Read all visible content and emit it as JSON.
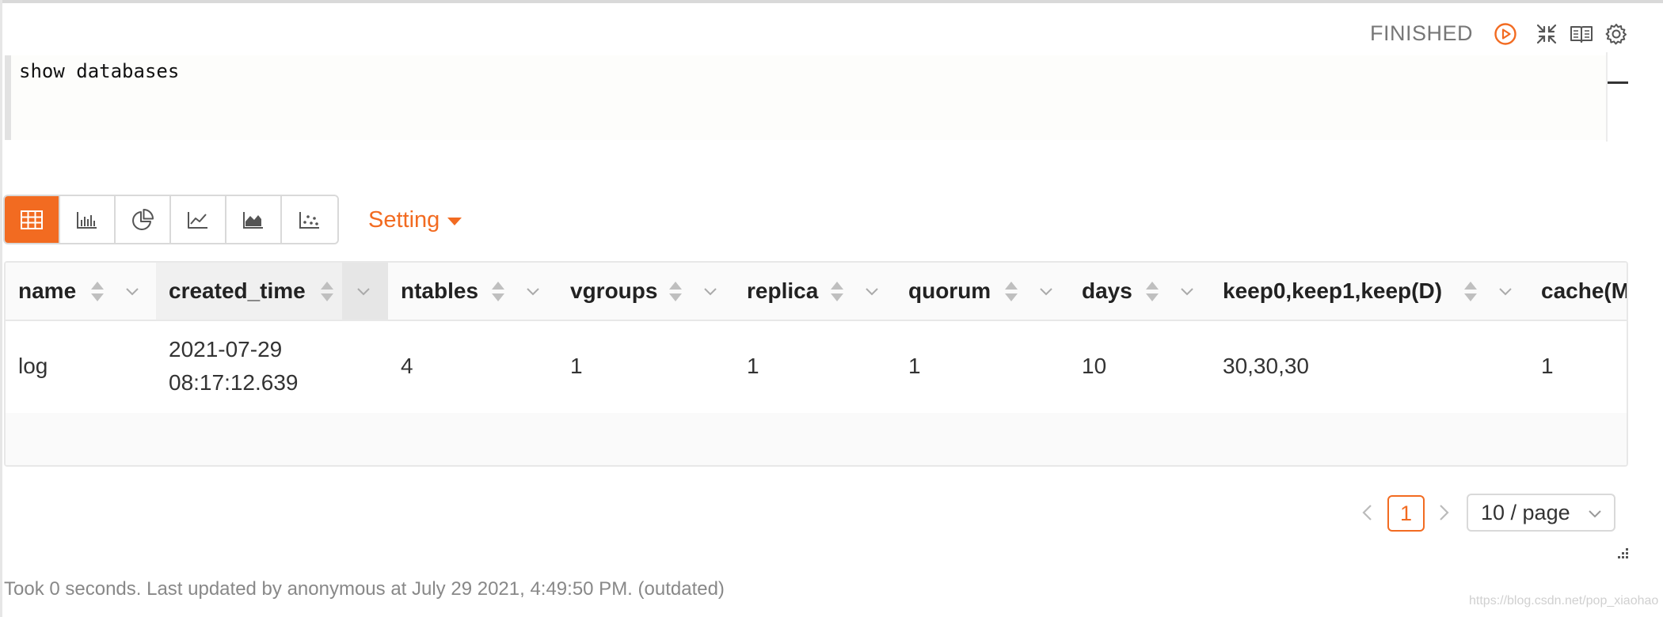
{
  "paragraph": {
    "status": "FINISHED",
    "editor_text": "show databases"
  },
  "icons": {
    "run": "play-circle-icon",
    "collapse": "collapse-arrows-icon",
    "book": "book-icon",
    "settings": "gear-icon"
  },
  "toolbar": {
    "buttons": [
      {
        "name": "table-view-button",
        "icon": "table-icon",
        "active": true
      },
      {
        "name": "bar-chart-button",
        "icon": "bar-chart-icon",
        "active": false
      },
      {
        "name": "pie-chart-button",
        "icon": "pie-chart-icon",
        "active": false
      },
      {
        "name": "line-chart-button",
        "icon": "line-chart-icon",
        "active": false
      },
      {
        "name": "area-chart-button",
        "icon": "area-chart-icon",
        "active": false
      },
      {
        "name": "scatter-chart-button",
        "icon": "scatter-chart-icon",
        "active": false
      }
    ],
    "setting_label": "Setting"
  },
  "table": {
    "columns": [
      "name",
      "created_time",
      "ntables",
      "vgroups",
      "replica",
      "quorum",
      "days",
      "keep0,keep1,keep(D)",
      "cache(M"
    ],
    "rows": [
      {
        "name": "log",
        "created_time_date": "2021-07-29",
        "created_time_time": "08:17:12.639",
        "ntables": "4",
        "vgroups": "1",
        "replica": "1",
        "quorum": "1",
        "days": "10",
        "keep": "30,30,30",
        "cache": "1"
      }
    ]
  },
  "pagination": {
    "current_page": "1",
    "page_size": "10 / page"
  },
  "footer": "Took 0 seconds. Last updated by anonymous at July 29 2021, 4:49:50 PM. (outdated)",
  "watermark": "https://blog.csdn.net/pop_xiaohao",
  "colors": {
    "accent": "#f26b21",
    "border": "#d9d9d9",
    "muted_text": "#888888"
  }
}
